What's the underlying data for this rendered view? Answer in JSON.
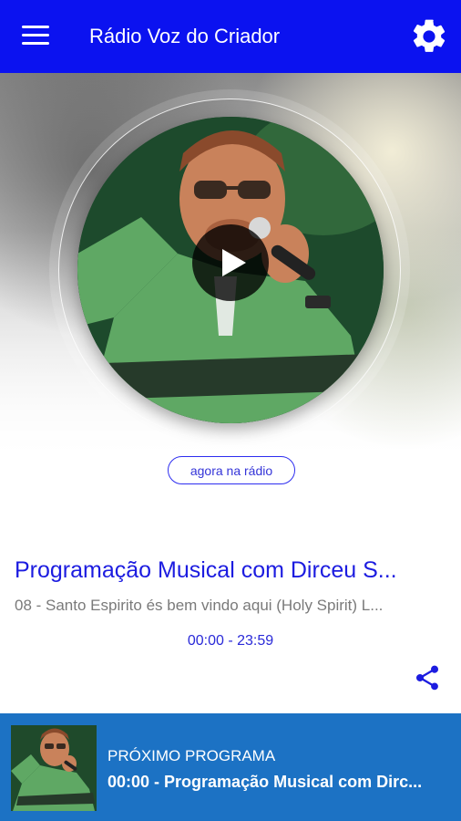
{
  "app": {
    "title": "Rádio Voz do Criador"
  },
  "topbar": {
    "menu_icon": "hamburger-menu-icon",
    "settings_icon": "gear-icon"
  },
  "hero": {
    "play_icon": "play-icon",
    "badge": "agora na rádio"
  },
  "now_playing": {
    "program": "Programação Musical com Dirceu S...",
    "track": "08 - Santo Espirito és bem vindo aqui (Holy Spirit) L...",
    "time_range": "00:00 - 23:59",
    "share_icon": "share-icon"
  },
  "next": {
    "label": "PRÓXIMO PROGRAMA",
    "title": "00:00 - Programação Musical com Dirc..."
  },
  "colors": {
    "topbar": "#0b12f0",
    "accent_text": "#1c1ce0",
    "bottombar": "#1c72c4"
  }
}
